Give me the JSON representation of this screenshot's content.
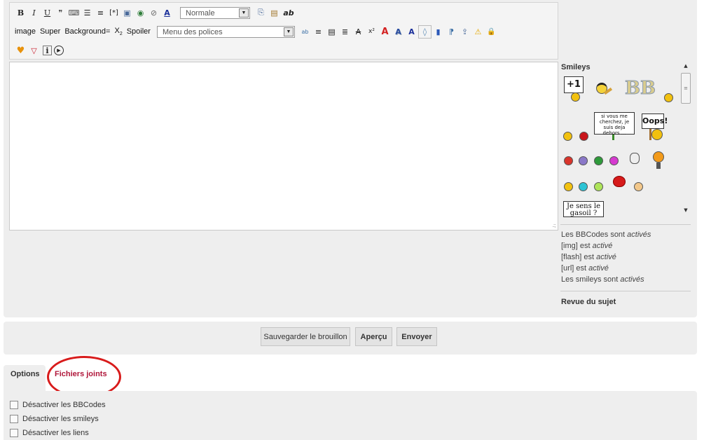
{
  "toolbar": {
    "row1": [
      {
        "name": "bold-button",
        "glyph": "B"
      },
      {
        "name": "italic-button",
        "glyph": "I"
      },
      {
        "name": "underline-button",
        "glyph": "U"
      },
      {
        "name": "quote-button",
        "glyph": "❞"
      },
      {
        "name": "code-button",
        "glyph": "⌨"
      },
      {
        "name": "list-button",
        "glyph": "☰"
      },
      {
        "name": "numbered-list-button",
        "glyph": "≡"
      },
      {
        "name": "list-item-button",
        "glyph": "[*]"
      },
      {
        "name": "image-button",
        "glyph": "▣"
      },
      {
        "name": "link-button",
        "glyph": "◉"
      },
      {
        "name": "flash-button",
        "glyph": "⊘"
      },
      {
        "name": "font-color-button",
        "glyph": "A"
      }
    ],
    "size_select": "Normale",
    "row1_after": [
      {
        "name": "copy-button",
        "glyph": "⎘"
      },
      {
        "name": "paste-button",
        "glyph": "▤"
      },
      {
        "name": "strike-ab-button",
        "glyph": "ab"
      }
    ],
    "row2_text_buttons": [
      "image",
      "Super",
      "Background="
    ],
    "subscript_label": "X",
    "spoiler_label": "Spoiler",
    "font_select": "Menu des polices",
    "row2_icons": [
      {
        "name": "spellcheck-icon",
        "glyph": "ab"
      },
      {
        "name": "align-center-icon",
        "glyph": "≡"
      },
      {
        "name": "align-justify-icon",
        "glyph": "▤"
      },
      {
        "name": "align-right-icon",
        "glyph": "≣"
      },
      {
        "name": "strike-icon",
        "glyph": "A"
      },
      {
        "name": "superscript-icon",
        "glyph": "x²"
      },
      {
        "name": "red-a-icon",
        "glyph": "A"
      },
      {
        "name": "shadow-a-icon",
        "glyph": "A"
      },
      {
        "name": "glow-a-icon",
        "glyph": "A"
      },
      {
        "name": "drop-icon",
        "glyph": "◊"
      },
      {
        "name": "gradient-icon",
        "glyph": "▮"
      },
      {
        "name": "direction-icon",
        "glyph": "⁋"
      },
      {
        "name": "upload-icon",
        "glyph": "⇪"
      },
      {
        "name": "warning-icon",
        "glyph": "⚠"
      },
      {
        "name": "lock-icon",
        "glyph": "🔒"
      }
    ],
    "row3_icons": [
      {
        "name": "love-icon",
        "glyph": "♥"
      },
      {
        "name": "funnel-icon",
        "glyph": "▽"
      },
      {
        "name": "info-icon",
        "glyph": "i"
      },
      {
        "name": "play-icon",
        "glyph": "▶"
      }
    ]
  },
  "smileys": {
    "title": "Smileys",
    "sign1": "+1",
    "sign2": "si vous me cherchez, je suis deja dehors ...",
    "sign3": "Oops!",
    "sign4": "Je sens le gasoil ?"
  },
  "info": {
    "bbcode_prefix": "Les BBCodes sont ",
    "bbcode_state": "activés",
    "img_prefix": "[img] est ",
    "img_state": "activé",
    "flash_prefix": "[flash] est ",
    "flash_state": "activé",
    "url_prefix": "[url] est ",
    "url_state": "activé",
    "smileys_prefix": "Les smileys sont ",
    "smileys_state": "activés"
  },
  "revue_label": "Revue du sujet",
  "buttons": {
    "save_draft": "Sauvegarder le brouillon",
    "preview": "Aperçu",
    "send": "Envoyer"
  },
  "tabs": {
    "options": "Options",
    "attachments": "Fichiers joints"
  },
  "options": {
    "disable_bbcodes": "Désactiver les BBCodes",
    "disable_smileys": "Désactiver les smileys",
    "disable_links": "Désactiver les liens"
  },
  "colors": {
    "panel_bg": "#eeeeee",
    "tab_active_text": "#b0163a",
    "highlight_circle": "#d81b1b"
  }
}
